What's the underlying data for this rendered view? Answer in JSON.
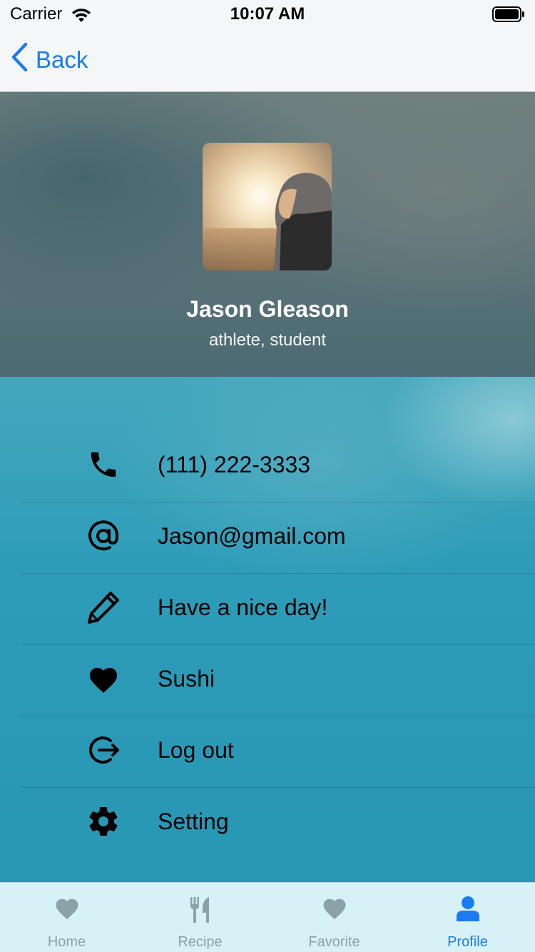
{
  "status_bar": {
    "carrier": "Carrier",
    "time": "10:07 AM"
  },
  "nav": {
    "back_label": "Back"
  },
  "profile": {
    "name": "Jason Gleason",
    "subtitle": "athlete, student"
  },
  "items": [
    {
      "icon": "phone-icon",
      "label": "(111) 222-3333"
    },
    {
      "icon": "at-sign-icon",
      "label": "Jason@gmail.com"
    },
    {
      "icon": "pencil-icon",
      "label": "Have a nice day!"
    },
    {
      "icon": "heart-icon",
      "label": "Sushi"
    },
    {
      "icon": "logout-icon",
      "label": "Log out"
    },
    {
      "icon": "gear-icon",
      "label": "Setting"
    }
  ],
  "tabs": [
    {
      "label": "Home",
      "icon": "heart-icon"
    },
    {
      "label": "Recipe",
      "icon": "fork-knife-icon"
    },
    {
      "label": "Favorite",
      "icon": "heart-icon"
    },
    {
      "label": "Profile",
      "icon": "person-icon",
      "active": true
    }
  ],
  "colors": {
    "accent": "#1a7cf0",
    "tab_inactive": "#8aa2a8",
    "tab_bar_bg": "#d7f2f6"
  }
}
